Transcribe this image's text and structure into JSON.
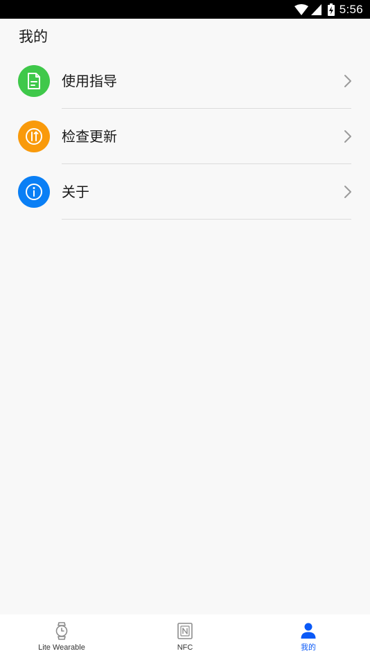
{
  "status_bar": {
    "time": "5:56",
    "icons": [
      "wifi-icon",
      "cell-signal-icon",
      "battery-charging-icon"
    ]
  },
  "page": {
    "title": "我的"
  },
  "menu": {
    "items": [
      {
        "label": "使用指导",
        "icon": "document-icon",
        "color": "#3fc84a"
      },
      {
        "label": "检查更新",
        "icon": "update-icon",
        "color": "#f99a0b"
      },
      {
        "label": "关于",
        "icon": "info-icon",
        "color": "#0a7ff5"
      }
    ]
  },
  "bottom_nav": {
    "tabs": [
      {
        "label": "Lite Wearable",
        "icon": "watch-icon",
        "active": false
      },
      {
        "label": "NFC",
        "icon": "nfc-icon",
        "active": false
      },
      {
        "label": "我的",
        "icon": "person-icon",
        "active": true
      }
    ],
    "active_color": "#0a59f7",
    "inactive_color": "#333333"
  }
}
